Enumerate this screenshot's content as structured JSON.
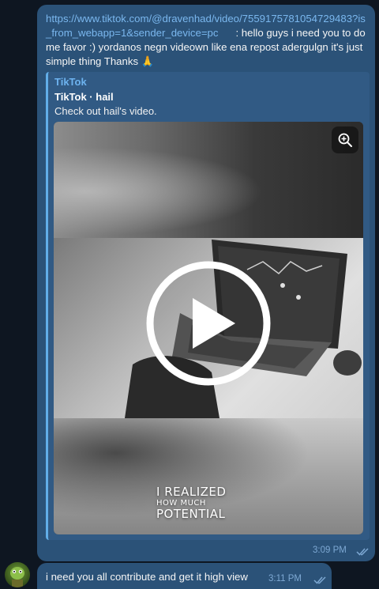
{
  "message1": {
    "link": "https://www.tiktok.com/@dravenhad/video/7559175781054729483?is_from_webapp=1&sender_device=pc",
    "text": ": hello guys i need you to do me favor :) yordanos negn videown like ena repost adergulgn it's just simple thing Thanks 🙏",
    "preview": {
      "site": "TikTok",
      "title": "TikTok · hail",
      "description": "Check out hail's video.",
      "caption_lines": [
        "I REALIZED",
        "HOW MUCH",
        "POTENTIAL"
      ]
    },
    "time": "3:09 PM"
  },
  "message2": {
    "text": "i need you all  contribute and get it high view",
    "time": "3:11 PM"
  },
  "icons": {
    "zoom": "zoom-in-icon",
    "play": "play-icon",
    "read": "double-check-icon"
  },
  "colors": {
    "background": "#0e1621",
    "bubble": "#2b5278",
    "link": "#7ab7ee",
    "accent": "#62aee8"
  }
}
